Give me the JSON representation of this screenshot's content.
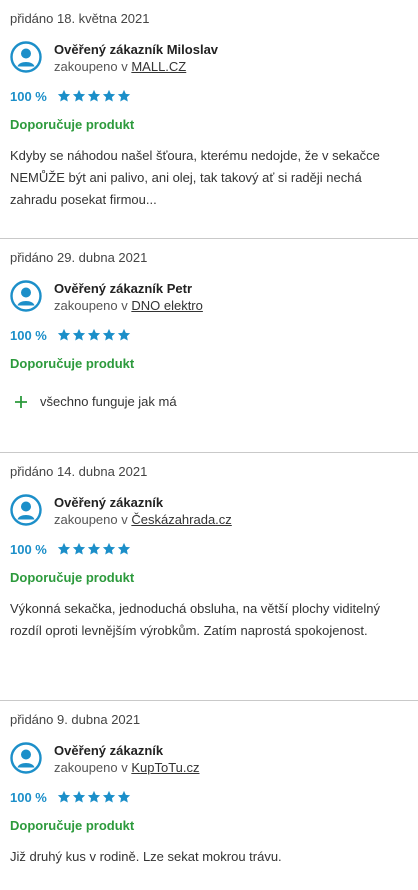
{
  "reviews": [
    {
      "date": "přidáno 18. května 2021",
      "author": "Ověřený zákazník Miloslav",
      "purchased_prefix": "zakoupeno v ",
      "shop": "MALL.CZ",
      "percent": "100 %",
      "rating": 5,
      "recommend": "Doporučuje produkt",
      "text": "Kdyby se náhodou našel šťoura, kterému nedojde, že v sekačce NEMŮŽE být ani palivo, ani olej, tak takový ať si raději nechá zahradu posekat firmou..."
    },
    {
      "date": "přidáno 29. dubna 2021",
      "author": "Ověřený zákazník Petr",
      "purchased_prefix": "zakoupeno v ",
      "shop": "DNO elektro",
      "percent": "100 %",
      "rating": 5,
      "recommend": "Doporučuje produkt",
      "pro": "všechno funguje jak má"
    },
    {
      "date": "přidáno 14. dubna 2021",
      "author": "Ověřený zákazník",
      "purchased_prefix": "zakoupeno v ",
      "shop": "Českázahrada.cz",
      "percent": "100 %",
      "rating": 5,
      "recommend": "Doporučuje produkt",
      "text": "Výkonná sekačka, jednoduchá obsluha, na větší plochy viditelný rozdíl oproti levnějším výrobkům. Zatím naprostá spokojenost."
    },
    {
      "date": "přidáno 9. dubna 2021",
      "author": "Ověřený zákazník",
      "purchased_prefix": "zakoupeno v ",
      "shop": "KupToTu.cz",
      "percent": "100 %",
      "rating": 5,
      "recommend": "Doporučuje produkt",
      "text": "Již druhý kus v rodině. Lze sekat mokrou trávu."
    }
  ],
  "colors": {
    "accent_blue": "#1c8fc9",
    "recommend_green": "#2c9a3c",
    "divider": "#c9c9c9"
  },
  "icons": {
    "avatar": "user-avatar-icon",
    "star": "star-icon",
    "pro": "plus-icon"
  }
}
